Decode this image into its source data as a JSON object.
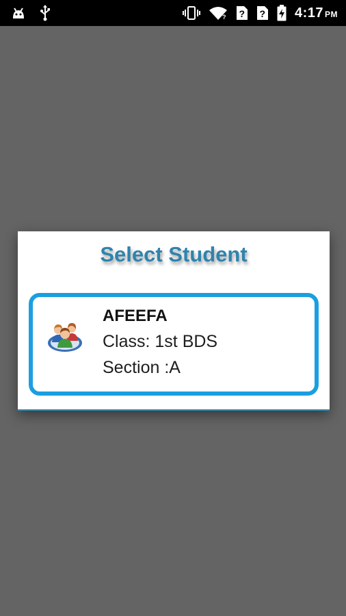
{
  "status_bar": {
    "time": "4:17",
    "ampm": "PM",
    "icons": [
      "android-icon",
      "usb-icon",
      "vibrate-icon",
      "wifi-icon",
      "sim-unknown-icon",
      "sim-unknown-icon",
      "battery-charging-icon"
    ]
  },
  "dialog": {
    "title": "Select Student",
    "students": [
      {
        "name": "AFEEFA",
        "class": "Class: 1st BDS",
        "section": "Section :A",
        "icon": "students-group-icon"
      }
    ]
  },
  "colors": {
    "background": "#646464",
    "title": "#2f84ad",
    "card_border": "#1a9fe0"
  }
}
